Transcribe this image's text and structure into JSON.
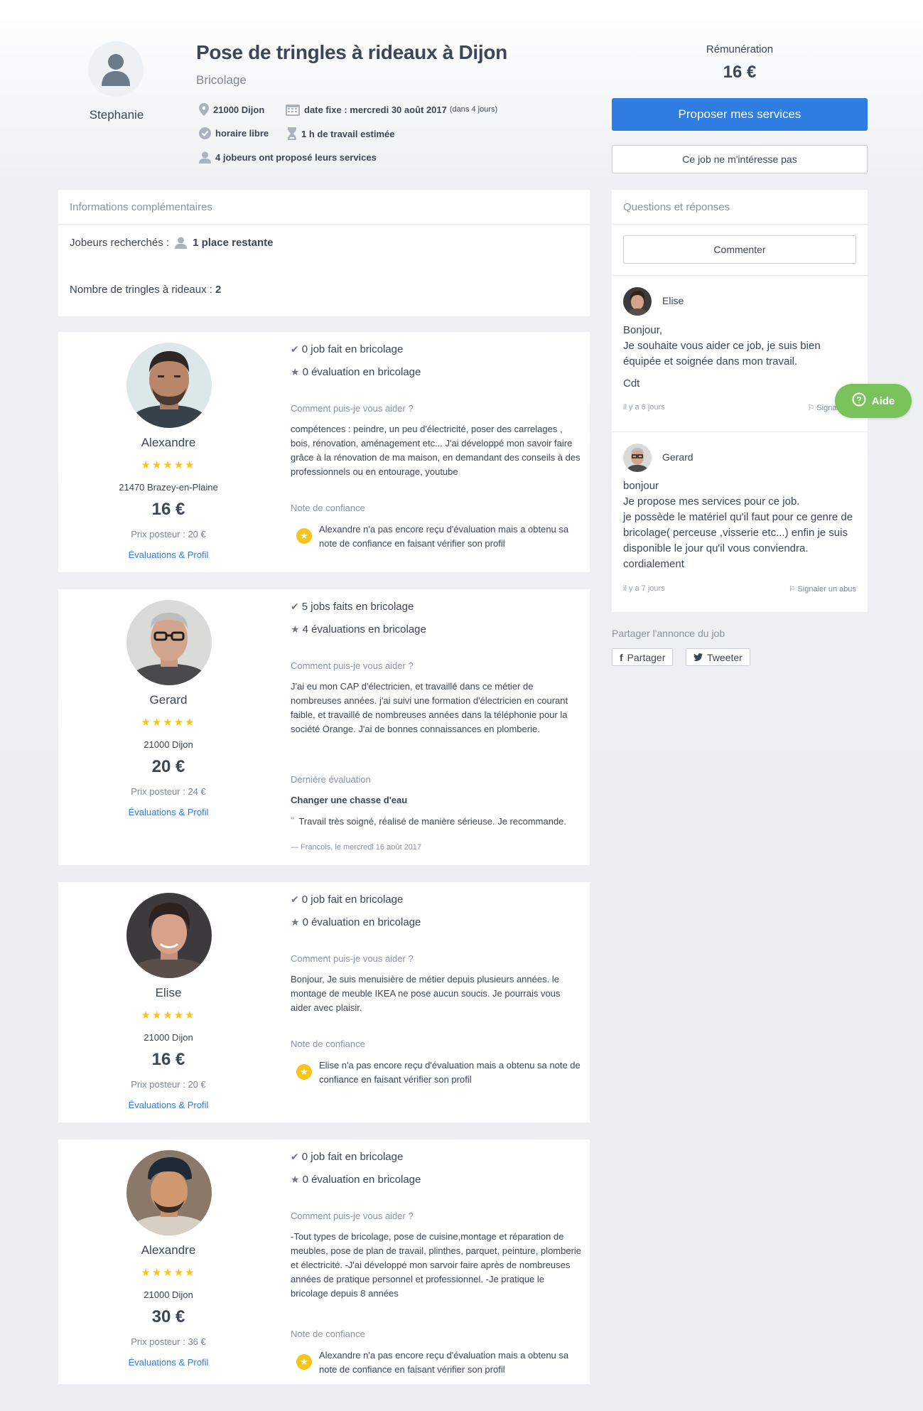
{
  "poster": {
    "name": "Stephanie"
  },
  "job": {
    "title": "Pose de tringles à rideaux à Dijon",
    "category": "Bricolage",
    "location": "21000 Dijon",
    "date_label": "date fixe : mercredi 30 août 2017",
    "date_relative": "(dans 4 jours)",
    "schedule": "horaire libre",
    "duration": "1 h de travail estimée",
    "offers": "4 jobeurs ont proposé leurs services"
  },
  "sidebar": {
    "remuneration_label": "Rémunération",
    "remuneration_value": "16 €",
    "propose_button": "Proposer mes services",
    "not_interested_button": "Ce job ne m'intéresse pas"
  },
  "info": {
    "header": "Informations complémentaires",
    "jobbers_label": "Jobeurs recherchés :",
    "jobbers_value": "1 place restante",
    "count_label": "Nombre de tringles à rideaux :",
    "count_value": "2"
  },
  "jobbers": [
    {
      "name": "Alexandre",
      "stars": "★★★★★",
      "city": "21470 Brazey-en-Plaine",
      "price": "16 €",
      "poster_price": "Prix posteur : 20 €",
      "profile_link": "Évaluations & Profil",
      "jobs_done": "0 job fait en bricolage",
      "evaluations": "0 évaluation en bricolage",
      "help_label": "Comment puis-je vous aider ?",
      "help_text": "compétences : peindre, un peu d'électricité, poser des carrelages , bois, rénovation, aménagement etc... J'ai développé mon savoir faire grâce à la rénovation de ma maison, en demandant des conseils à des professionnels ou en entourage, youtube",
      "trust_label": "Note de confiance",
      "trust_text": "Alexandre n'a pas encore reçu d'évaluation mais a obtenu sa note de confiance en faisant vérifier son profil"
    },
    {
      "name": "Gerard",
      "stars": "★★★★★",
      "city": "21000 Dijon",
      "price": "20 €",
      "poster_price": "Prix posteur : 24 €",
      "profile_link": "Évaluations & Profil",
      "jobs_done": "5 jobs faits en bricolage",
      "evaluations": "4 évaluations en bricolage",
      "help_label": "Comment puis-je vous aider ?",
      "help_text": "J'ai eu mon CAP d'électricien, et travaillé dans ce métier de nombreuses années. j'ai suivi une formation d'électricien en courant faible, et travaillé de nombreuses années dans la téléphonie pour la société Orange. J'ai de bonnes connaissances en plomberie.",
      "last_eval_label": "Dernière évaluation",
      "last_eval_title": "Changer une chasse d'eau",
      "last_eval_text": "Travail très soigné, réalisé de manière sérieuse. Je recommande.",
      "last_eval_author": "— Francois, le mercredi 16 août 2017"
    },
    {
      "name": "Elise",
      "stars": "★★★★★",
      "city": "21000 Dijon",
      "price": "16 €",
      "poster_price": "Prix posteur : 20 €",
      "profile_link": "Évaluations & Profil",
      "jobs_done": "0 job fait en bricolage",
      "evaluations": "0 évaluation en bricolage",
      "help_label": "Comment puis-je vous aider ?",
      "help_text": "Bonjour, Je suis menuisière de métier depuis plusieurs années. le montage de meuble IKEA ne pose aucun soucis. Je pourrais vous aider avec plaisir.",
      "trust_label": "Note de confiance",
      "trust_text": "Elise n'a pas encore reçu d'évaluation mais a obtenu sa note de confiance en faisant vérifier son profil"
    },
    {
      "name": "Alexandre",
      "stars": "★★★★★",
      "city": "21000 Dijon",
      "price": "30 €",
      "poster_price": "Prix posteur : 36 €",
      "profile_link": "Évaluations & Profil",
      "jobs_done": "0 job fait en bricolage",
      "evaluations": "0 évaluation en bricolage",
      "help_label": "Comment puis-je vous aider ?",
      "help_text": "-Tout types de bricolage, pose de cuisine,montage et réparation de meubles, pose de plan de travail, plinthes, parquet, peinture, plomberie et électricité. -J'ai développé mon sarvoir faire après de nombreuses années de pratique personnel et professionnel. -Je pratique le bricolage depuis 8 années",
      "trust_label": "Note de confiance",
      "trust_text": "Alexandre n'a pas encore reçu d'évaluation mais a obtenu sa note de confiance en faisant vérifier son profil"
    }
  ],
  "qa": {
    "header": "Questions et réponses",
    "comment_button": "Commenter",
    "items": [
      {
        "name": "Elise",
        "lines": [
          "Bonjour,",
          "Je souhaite vous aider ce job, je suis bien équipée et soignée dans mon travail.",
          "Cdt"
        ],
        "time": "il y a 6 jours",
        "report": "Signaler un"
      },
      {
        "name": "Gerard",
        "lines": [
          "bonjour",
          "Je propose mes services pour ce job.",
          "je possède le matériel qu'il faut pour ce genre de bricolage( perceuse ,visserie etc...) enfin je suis disponible le jour qu'il vous conviendra.",
          "cordialement"
        ],
        "time": "il y a 7 jours",
        "report": "Signaler un abus"
      }
    ]
  },
  "share": {
    "label": "Partager l'annonce du job",
    "facebook": "Partager",
    "twitter": "Tweeter"
  },
  "help": {
    "label": "Aide"
  },
  "colors": {
    "primary": "#2f7de1",
    "star": "#f6c41b",
    "help": "#7ac25a"
  }
}
